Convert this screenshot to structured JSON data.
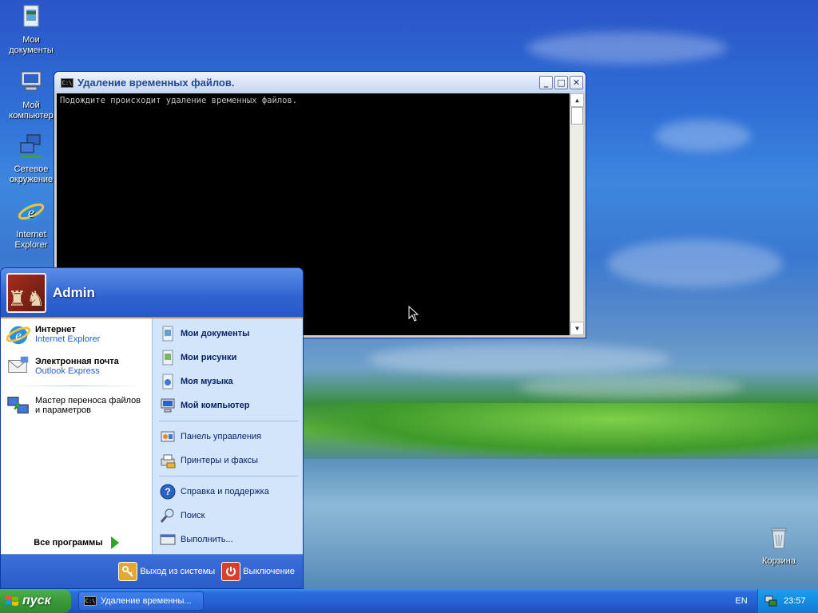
{
  "desktop": {
    "icons": [
      {
        "label": "Мои документы",
        "icon": "my-documents-icon"
      },
      {
        "label": "Мой компьютер",
        "icon": "my-computer-icon"
      },
      {
        "label": "Сетевое окружение",
        "icon": "network-places-icon"
      },
      {
        "label": "Internet Explorer",
        "icon": "internet-explorer-icon"
      },
      {
        "label": "Корзина",
        "icon": "recycle-bin-icon"
      }
    ]
  },
  "console": {
    "title": "Удаление временных файлов.",
    "icon_text": "C:\\",
    "output": "Подождите происходит удаление временных файлов."
  },
  "start_menu": {
    "user": "Admin",
    "pinned": [
      {
        "title": "Интернет",
        "subtitle": "Internet Explorer",
        "icon": "internet-explorer-icon"
      },
      {
        "title": "Электронная почта",
        "subtitle": "Outlook Express",
        "icon": "outlook-express-icon"
      }
    ],
    "recent": [
      {
        "title": "Мастер переноса файлов и параметров",
        "icon": "transfer-wizard-icon"
      }
    ],
    "all_programs": "Все программы",
    "right": {
      "places": [
        "Мои документы",
        "Мои рисунки",
        "Моя музыка",
        "Мой компьютер"
      ],
      "settings": [
        "Панель управления",
        "Принтеры и факсы"
      ],
      "tools": [
        "Справка и поддержка",
        "Поиск",
        "Выполнить..."
      ]
    },
    "footer": {
      "logoff": "Выход из системы",
      "shutdown": "Выключение"
    }
  },
  "taskbar": {
    "start_label": "пуск",
    "task": "Удаление временны...",
    "language": "EN",
    "clock": "23:57"
  },
  "colors": {
    "taskbar_blue": "#245fd3",
    "start_green": "#3b9a3b",
    "tray_blue": "#138ee4",
    "start_menu_accent": "#e8862b"
  }
}
